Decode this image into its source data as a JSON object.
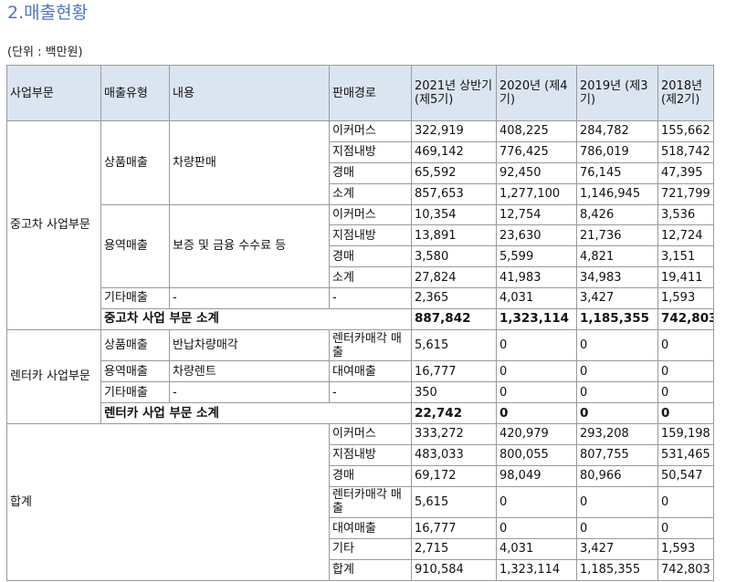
{
  "section_title": "2.매출현황",
  "unit_note": "(단위 : 백만원)",
  "headers": {
    "segment": "사업부문",
    "sales_type": "매출유형",
    "content": "내용",
    "channel": "판매경로",
    "y2021": "2021년 상반기 (제5기)",
    "y2020": "2020년 (제4기)",
    "y2019": "2019년 (제3기)",
    "y2018": "2018년 (제2기)"
  },
  "used_car": {
    "segment": "중고차 사업부문",
    "goods": {
      "type": "상품매출",
      "content": "차량판매",
      "rows": [
        {
          "channel": "이커머스",
          "v2021": "322,919",
          "v2020": "408,225",
          "v2019": "284,782",
          "v2018": "155,662"
        },
        {
          "channel": "지점내방",
          "v2021": "469,142",
          "v2020": "776,425",
          "v2019": "786,019",
          "v2018": "518,742"
        },
        {
          "channel": "경매",
          "v2021": "65,592",
          "v2020": "92,450",
          "v2019": "76,145",
          "v2018": "47,395"
        },
        {
          "channel": "소계",
          "v2021": "857,653",
          "v2020": "1,277,100",
          "v2019": "1,146,945",
          "v2018": "721,799"
        }
      ]
    },
    "service": {
      "type": "용역매출",
      "content": "보증 및 금융 수수료 등",
      "rows": [
        {
          "channel": "이커머스",
          "v2021": "10,354",
          "v2020": "12,754",
          "v2019": "8,426",
          "v2018": "3,536"
        },
        {
          "channel": "지점내방",
          "v2021": "13,891",
          "v2020": "23,630",
          "v2019": "21,736",
          "v2018": "12,724"
        },
        {
          "channel": "경매",
          "v2021": "3,580",
          "v2020": "5,599",
          "v2019": "4,821",
          "v2018": "3,151"
        },
        {
          "channel": "소계",
          "v2021": "27,824",
          "v2020": "41,983",
          "v2019": "34,983",
          "v2018": "19,411"
        }
      ]
    },
    "other": {
      "type": "기타매출",
      "content": "-",
      "channel": "-",
      "v2021": "2,365",
      "v2020": "4,031",
      "v2019": "3,427",
      "v2018": "1,593"
    },
    "subtotal": {
      "label": "중고차 사업 부문 소계",
      "v2021": "887,842",
      "v2020": "1,323,114",
      "v2019": "1,185,355",
      "v2018": "742,803"
    }
  },
  "rental": {
    "segment": "렌터카 사업부문",
    "rows": [
      {
        "type": "상품매출",
        "content": "반납차량매각",
        "channel": "렌터카매각 매출",
        "v2021": "5,615",
        "v2020": "0",
        "v2019": "0",
        "v2018": "0"
      },
      {
        "type": "용역매출",
        "content": "차량렌트",
        "channel": "대여매출",
        "v2021": "16,777",
        "v2020": "0",
        "v2019": "0",
        "v2018": "0"
      },
      {
        "type": "기타매출",
        "content": "-",
        "channel": "-",
        "v2021": "350",
        "v2020": "0",
        "v2019": "0",
        "v2018": "0"
      }
    ],
    "subtotal": {
      "label": "렌터카 사업 부문 소계",
      "v2021": "22,742",
      "v2020": "0",
      "v2019": "0",
      "v2018": "0"
    }
  },
  "total": {
    "segment": "합계",
    "rows": [
      {
        "channel": "이커머스",
        "v2021": "333,272",
        "v2020": "420,979",
        "v2019": "293,208",
        "v2018": "159,198"
      },
      {
        "channel": "지점내방",
        "v2021": "483,033",
        "v2020": "800,055",
        "v2019": "807,755",
        "v2018": "531,465"
      },
      {
        "channel": "경매",
        "v2021": "69,172",
        "v2020": "98,049",
        "v2019": "80,966",
        "v2018": "50,547"
      },
      {
        "channel": "렌터카매각 매출",
        "v2021": "5,615",
        "v2020": "0",
        "v2019": "0",
        "v2018": "0"
      },
      {
        "channel": "대여매출",
        "v2021": "16,777",
        "v2020": "0",
        "v2019": "0",
        "v2018": "0"
      },
      {
        "channel": "기타",
        "v2021": "2,715",
        "v2020": "4,031",
        "v2019": "3,427",
        "v2018": "1,593"
      },
      {
        "channel": "합계",
        "v2021": "910,584",
        "v2020": "1,323,114",
        "v2019": "1,185,355",
        "v2018": "742,803"
      }
    ]
  }
}
